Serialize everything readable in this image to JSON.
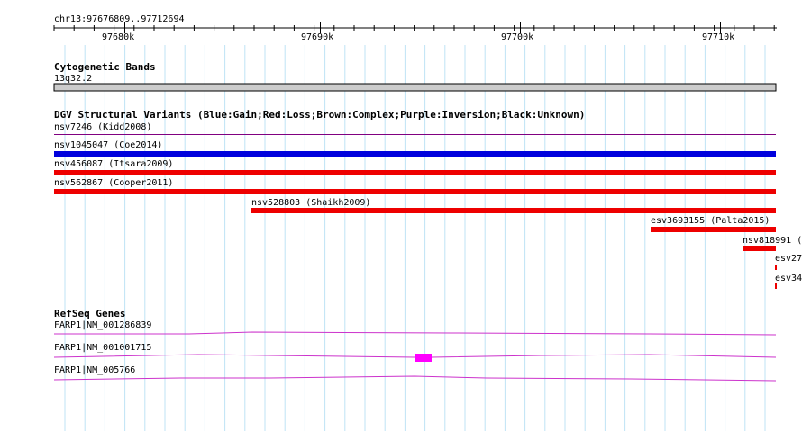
{
  "ruler": {
    "region": "chr13:97676809..97712694",
    "ticks": [
      "97680k",
      "97690k",
      "97700k",
      "97710k"
    ]
  },
  "tracks": {
    "cyto": {
      "title": "Cytogenetic Bands",
      "band": "13q32.2"
    },
    "dgv": {
      "title": "DGV Structural Variants (Blue:Gain;Red:Loss;Brown:Complex;Purple:Inversion;Black:Unknown)",
      "variants": [
        {
          "label": "nsv7246 (Kidd2008)",
          "type": "Inversion",
          "color": "#800080"
        },
        {
          "label": "nsv1045047 (Coe2014)",
          "type": "Gain",
          "color": "#0000dd"
        },
        {
          "label": "nsv456087 (Itsara2009)",
          "type": "Loss",
          "color": "#ee0000"
        },
        {
          "label": "nsv562867 (Cooper2011)",
          "type": "Loss",
          "color": "#ee0000"
        },
        {
          "label": "nsv528803 (Shaikh2009)",
          "type": "Loss",
          "color": "#ee0000"
        },
        {
          "label": "esv3693155 (Palta2015)",
          "type": "Loss",
          "color": "#ee0000"
        },
        {
          "label": "nsv818991 (",
          "type": "Loss",
          "color": "#ee0000"
        },
        {
          "label": "esv27",
          "type": "Loss",
          "color": "#ee0000"
        },
        {
          "label": "esv34",
          "type": "Loss",
          "color": "#ee0000"
        }
      ]
    },
    "refseq": {
      "title": "RefSeq Genes",
      "genes": [
        {
          "label": "FARP1|NM_001286839"
        },
        {
          "label": "FARP1|NM_001001715"
        },
        {
          "label": "FARP1|NM_005766"
        }
      ]
    }
  },
  "colors": {
    "grid": "#bfe3f5",
    "band_fill": "#cccccc",
    "gene": "#cc33cc",
    "exon": "#ff00ff"
  }
}
